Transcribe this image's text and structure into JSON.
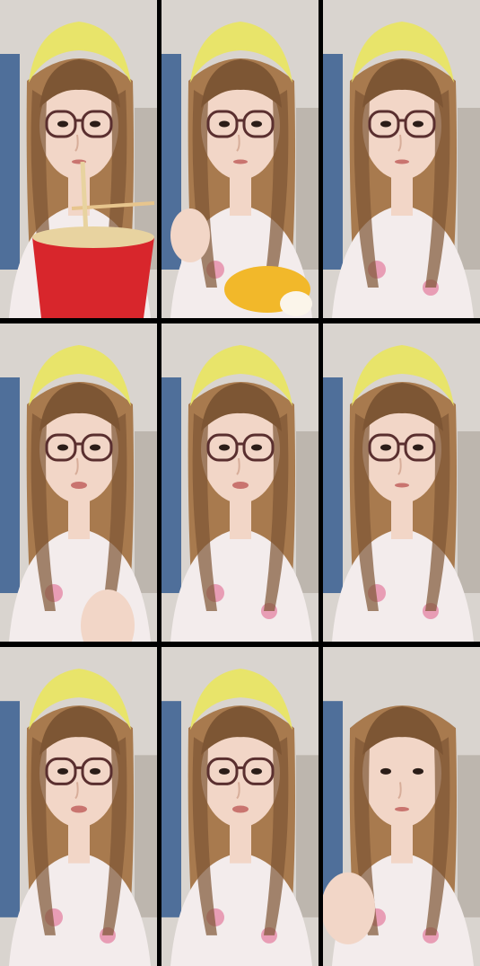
{
  "grid": {
    "rows": 3,
    "cols": 3,
    "background_color": "#000000"
  },
  "colors": {
    "wall": "#d9d4cf",
    "wall_shadow": "#bdb6ae",
    "door_blue": "#4f6f9a",
    "hair": "#a87a4e",
    "hair_dark": "#7d5634",
    "skin": "#f2d6c7",
    "headband": "#e8e46a",
    "glasses": "#5a2f2f",
    "pajama": "#f3ecec",
    "pajama_pattern": "#e58aa8",
    "cup_red": "#d8262c",
    "mango": "#f2b82a"
  },
  "panels": [
    {
      "id": "p1",
      "headband": true,
      "glasses": true,
      "scene": "eating-noodles"
    },
    {
      "id": "p2",
      "headband": true,
      "glasses": true,
      "scene": "eating-mango"
    },
    {
      "id": "p3",
      "headband": true,
      "glasses": true,
      "scene": "portrait"
    },
    {
      "id": "p4",
      "headband": true,
      "glasses": true,
      "scene": "talking-hand"
    },
    {
      "id": "p5",
      "headband": true,
      "glasses": true,
      "scene": "talking"
    },
    {
      "id": "p6",
      "headband": true,
      "glasses": true,
      "scene": "portrait"
    },
    {
      "id": "p7",
      "headband": true,
      "glasses": true,
      "scene": "talking"
    },
    {
      "id": "p8",
      "headband": true,
      "glasses": true,
      "scene": "talking"
    },
    {
      "id": "p9",
      "headband": false,
      "glasses": false,
      "scene": "hand-wave"
    }
  ]
}
